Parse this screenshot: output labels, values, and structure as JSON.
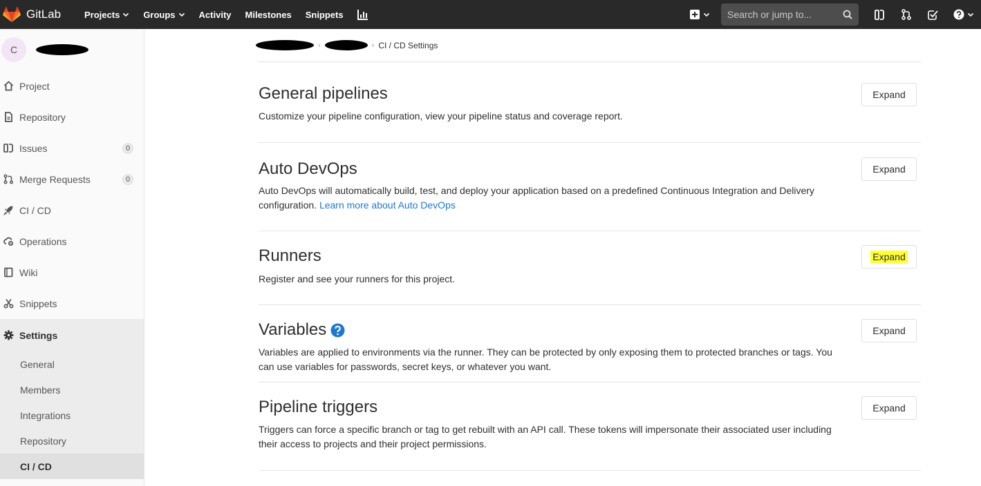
{
  "navbar": {
    "brand": "GitLab",
    "items": [
      {
        "label": "Projects",
        "has_caret": true
      },
      {
        "label": "Groups",
        "has_caret": true
      },
      {
        "label": "Activity",
        "has_caret": false
      },
      {
        "label": "Milestones",
        "has_caret": false
      },
      {
        "label": "Snippets",
        "has_caret": false
      }
    ],
    "search_placeholder": "Search or jump to...",
    "icons": [
      "chart-icon",
      "plus-square-icon",
      "search-icon",
      "sidebar-toggle-icon",
      "merge-request-icon",
      "todo-check-icon",
      "help-icon"
    ]
  },
  "sidebar": {
    "avatar_letter": "C",
    "items": [
      {
        "label": "Project",
        "icon": "home-icon"
      },
      {
        "label": "Repository",
        "icon": "doc-icon"
      },
      {
        "label": "Issues",
        "icon": "issues-icon",
        "badge": "0"
      },
      {
        "label": "Merge Requests",
        "icon": "merge-icon",
        "badge": "0"
      },
      {
        "label": "CI / CD",
        "icon": "rocket-icon"
      },
      {
        "label": "Operations",
        "icon": "cloud-gear-icon"
      },
      {
        "label": "Wiki",
        "icon": "book-icon"
      },
      {
        "label": "Snippets",
        "icon": "scissors-icon"
      }
    ],
    "settings_label": "Settings",
    "settings_sub": [
      "General",
      "Members",
      "Integrations",
      "Repository",
      "CI / CD"
    ]
  },
  "breadcrumb": {
    "current": "CI / CD Settings"
  },
  "sections": [
    {
      "title": "General pipelines",
      "desc": "Customize your pipeline configuration, view your pipeline status and coverage report.",
      "button": "Expand"
    },
    {
      "title": "Auto DevOps",
      "desc": "Auto DevOps will automatically build, test, and deploy your application based on a predefined Continuous Integration and Delivery configuration.",
      "link": "Learn more about Auto DevOps",
      "button": "Expand"
    },
    {
      "title": "Runners",
      "desc": "Register and see your runners for this project.",
      "button": "Expand",
      "highlighted": true
    },
    {
      "title": "Variables",
      "desc": "Variables are applied to environments via the runner. They can be protected by only exposing them to protected branches or tags. You can use variables for passwords, secret keys, or whatever you want.",
      "button": "Expand"
    },
    {
      "title": "Pipeline triggers",
      "desc": "Triggers can force a specific branch or tag to get rebuilt with an API call. These tokens will impersonate their associated user including their access to projects and their project permissions.",
      "button": "Expand"
    }
  ],
  "colors": {
    "navbar": "#292929",
    "link": "#1f78d1",
    "highlight": "#ffff33",
    "help_icon": "#1f78d1"
  }
}
